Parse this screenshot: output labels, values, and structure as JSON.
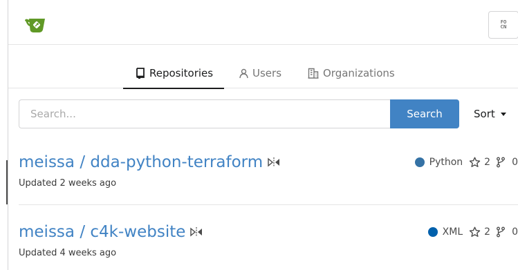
{
  "colors": {
    "accent": "#4183c4",
    "python": "#3572A5",
    "xml": "#0060ac"
  },
  "header": {
    "logo_icon": "gitea-teacup-icon",
    "language_button_text": "FO CN"
  },
  "tabs": [
    {
      "label": "Repositories",
      "icon": "book-icon",
      "active": true
    },
    {
      "label": "Users",
      "icon": "person-icon",
      "active": false
    },
    {
      "label": "Organizations",
      "icon": "organization-icon",
      "active": false
    }
  ],
  "search": {
    "placeholder": "Search...",
    "value": "",
    "button_label": "Search",
    "sort_label": "Sort"
  },
  "repos": [
    {
      "owner": "meissa",
      "name": "dda-python-terraform",
      "full_name": "meissa / dda-python-terraform",
      "icon": "mirror-icon",
      "language": "Python",
      "stars": "2",
      "forks": "0",
      "updated": "Updated 2 weeks ago"
    },
    {
      "owner": "meissa",
      "name": "c4k-website",
      "full_name": "meissa / c4k-website",
      "icon": "mirror-icon",
      "language": "XML",
      "stars": "2",
      "forks": "0",
      "updated": "Updated 4 weeks ago"
    }
  ]
}
